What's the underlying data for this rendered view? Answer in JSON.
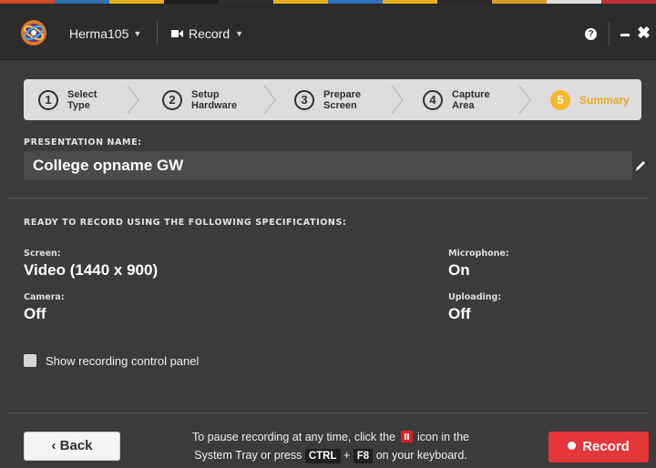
{
  "header": {
    "user_label": "Herma105",
    "record_label": "Record",
    "strip_colors": [
      "#d04a2a",
      "#2f6fb0",
      "#e8b020",
      "#1f1f1f",
      "#2f2f2f",
      "#e8b020",
      "#3070c0",
      "#e8b020",
      "#2a2a2a",
      "#d4a020",
      "#e0e0e0",
      "#c03030"
    ]
  },
  "steps": [
    {
      "num": "1",
      "line1": "Select",
      "line2": "Type"
    },
    {
      "num": "2",
      "line1": "Setup",
      "line2": "Hardware"
    },
    {
      "num": "3",
      "line1": "Prepare",
      "line2": "Screen"
    },
    {
      "num": "4",
      "line1": "Capture",
      "line2": "Area"
    },
    {
      "num": "5",
      "line1": "Summary",
      "line2": ""
    }
  ],
  "presentation": {
    "label": "PRESENTATION NAME:",
    "value": "College opname GW"
  },
  "specs": {
    "heading": "READY TO RECORD USING THE FOLLOWING SPECIFICATIONS:",
    "screen_label": "Screen:",
    "screen_value": "Video (1440 x 900)",
    "camera_label": "Camera:",
    "camera_value": "Off",
    "microphone_label": "Microphone:",
    "microphone_value": "On",
    "uploading_label": "Uploading:",
    "uploading_value": "Off"
  },
  "options": {
    "show_panel_label": "Show recording control panel",
    "show_panel_checked": false
  },
  "footer": {
    "back_label": "Back",
    "hint_part1": "To pause recording at any time, click the",
    "hint_part2": "icon in the",
    "hint_part3": "System Tray or press",
    "key1": "CTRL",
    "plus": "+",
    "key2": "F8",
    "hint_part4": "on your keyboard.",
    "record_label": "Record"
  },
  "colors": {
    "accent": "#f5b82e",
    "record": "#e5373a"
  }
}
